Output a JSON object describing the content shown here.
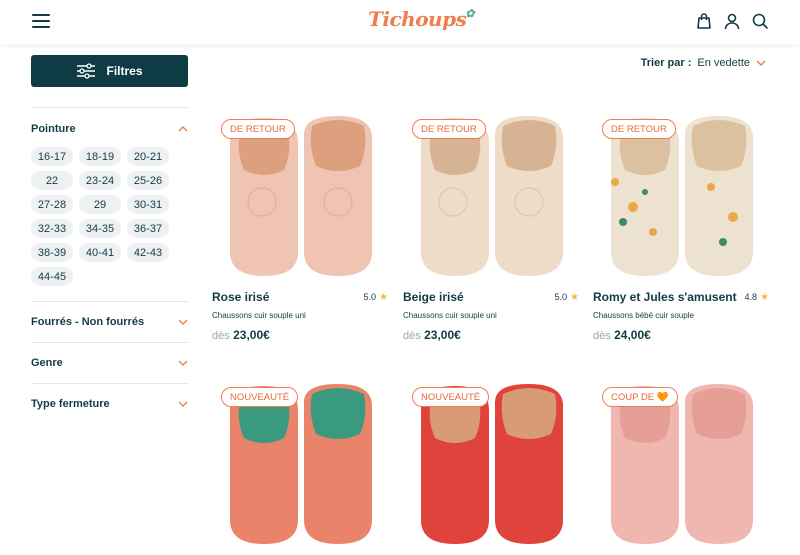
{
  "header": {
    "logo": "Tichoups",
    "logo_sprout": "✿"
  },
  "sidebar": {
    "filter_label": "Filtres",
    "sections": [
      {
        "label": "Pointure",
        "expanded": true
      },
      {
        "label": "Fourrés - Non fourrés",
        "expanded": false
      },
      {
        "label": "Genre",
        "expanded": false
      },
      {
        "label": "Type fermeture",
        "expanded": false
      }
    ],
    "sizes": [
      "16-17",
      "18-19",
      "20-21",
      "22",
      "23-24",
      "25-26",
      "27-28",
      "29",
      "30-31",
      "32-33",
      "34-35",
      "36-37",
      "38-39",
      "40-41",
      "42-43",
      "44-45"
    ]
  },
  "sort": {
    "label": "Trier par :",
    "value": "En vedette"
  },
  "products": [
    {
      "badge": "DE RETOUR",
      "name": "Rose irisé",
      "rating": "5.0",
      "desc": "Chaussons cuir souple uni",
      "from": "dès",
      "price": "23,00€",
      "color": "#efc4b2",
      "inner": "#dda07f"
    },
    {
      "badge": "DE RETOUR",
      "name": "Beige irisé",
      "rating": "5.0",
      "desc": "Chaussons cuir souple uni",
      "from": "dès",
      "price": "23,00€",
      "color": "#efdcc8",
      "inner": "#d5b393"
    },
    {
      "badge": "DE RETOUR",
      "name": "Romy et Jules s'amusent",
      "rating": "4.8",
      "desc": "Chaussons bébé cuir souple",
      "from": "dès",
      "price": "24,00€",
      "color": "#ece2cf",
      "inner": "#dcc1a0"
    },
    {
      "badge": "NOUVEAUTÉ",
      "name": "",
      "rating": "",
      "desc": "",
      "from": "",
      "price": "",
      "color": "#e9846b",
      "inner": "#3a9a7e"
    },
    {
      "badge": "NOUVEAUTÉ",
      "name": "",
      "rating": "",
      "desc": "",
      "from": "",
      "price": "",
      "color": "#e0433b",
      "inner": "#d79c75"
    },
    {
      "badge": "COUP DE 🧡",
      "name": "",
      "rating": "",
      "desc": "",
      "from": "",
      "price": "",
      "color": "#f0b6b0",
      "inner": "#e59f97"
    }
  ],
  "colors": {
    "brand": "#f07d4f",
    "dark": "#0f3b45",
    "star": "#f5b942"
  }
}
